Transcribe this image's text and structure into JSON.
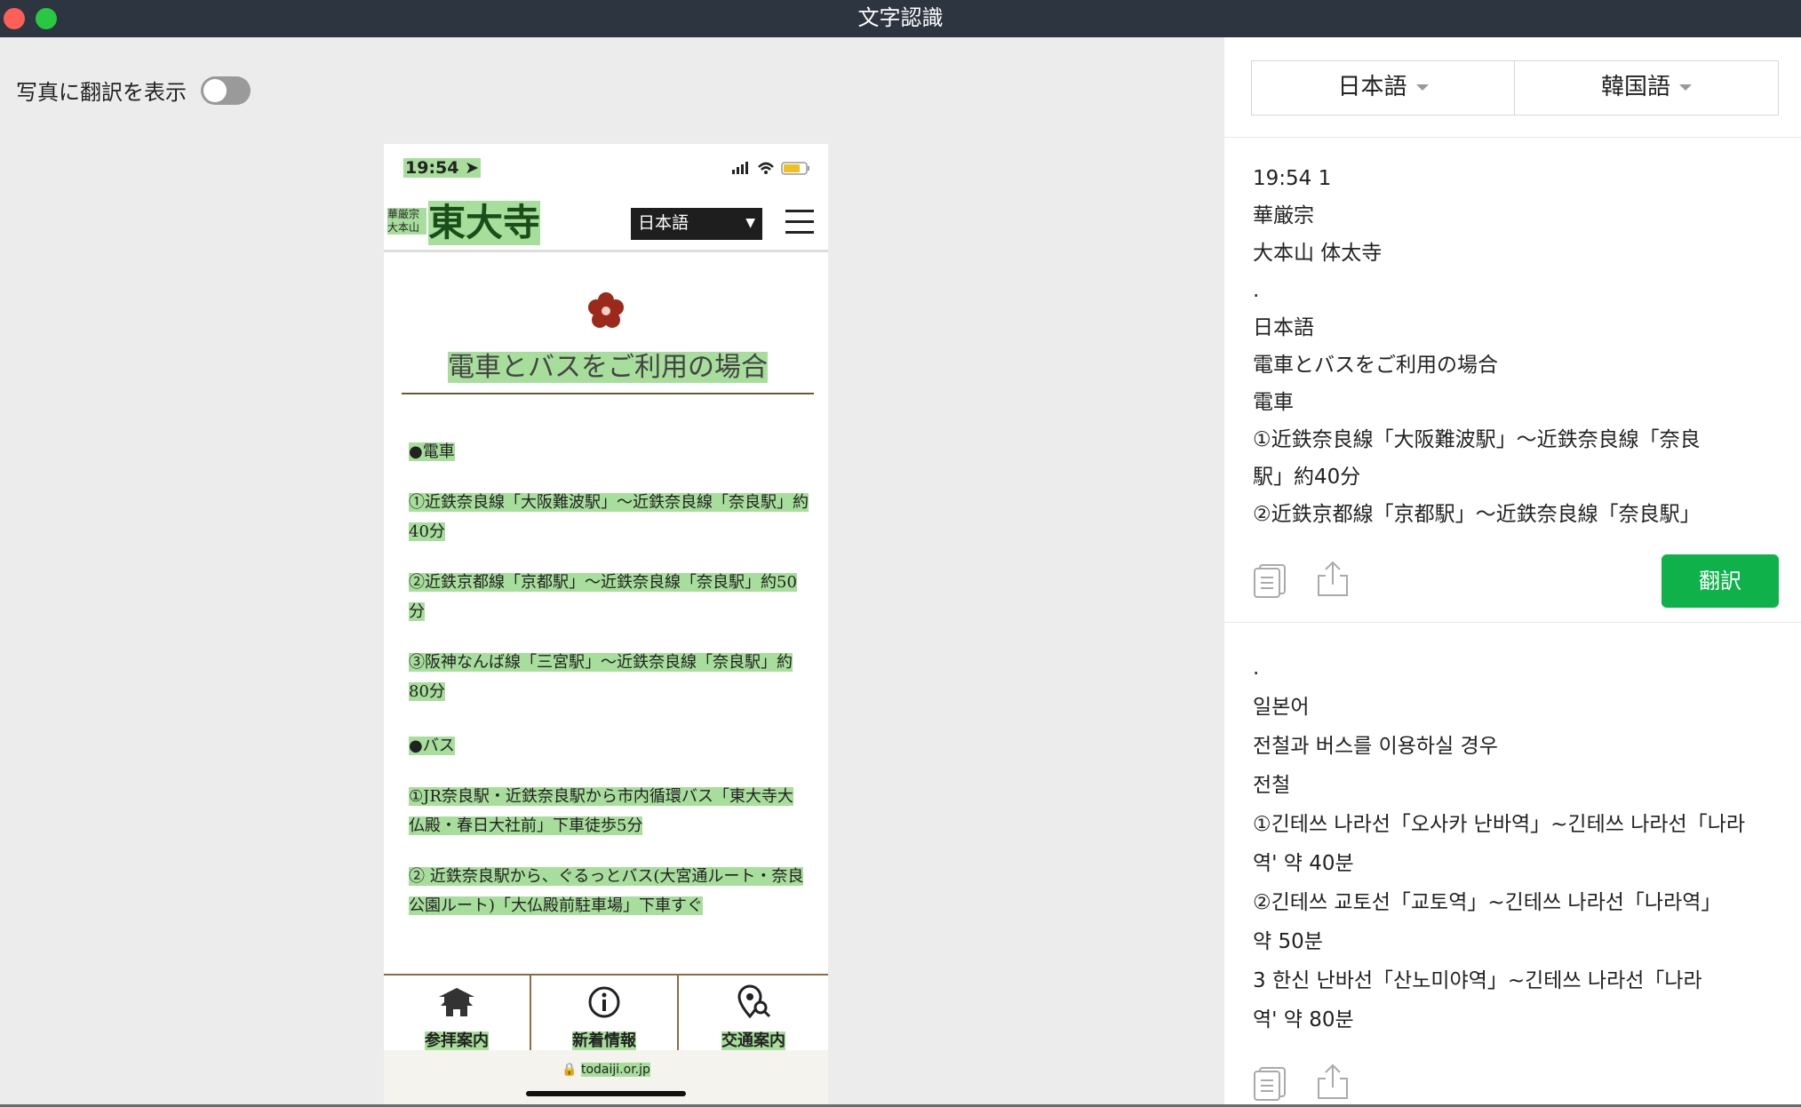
{
  "window": {
    "title": "文字認識",
    "close_color": "#ff5f57",
    "zoom_color": "#28c840"
  },
  "left": {
    "toggle_label": "写真に翻訳を表示",
    "toggle_on": false
  },
  "phone": {
    "status_time": "19:54",
    "logo_small": "華厳宗\n大本山",
    "logo_big": "東大寺",
    "lang_select": "日本語",
    "heading": "電車とバスをご利用の場合",
    "body": [
      "●電車",
      "①近鉄奈良線「大阪難波駅」〜近鉄奈良線「奈良駅」約40分",
      "②近鉄京都線「京都駅」〜近鉄奈良線「奈良駅」約50分",
      "③阪神なんば線「三宮駅」〜近鉄奈良線「奈良駅」約80分",
      "●バス",
      "①JR奈良駅・近鉄奈良駅から市内循環バス「東大寺大仏殿・春日大社前」下車徒歩5分",
      "② 近鉄奈良駅から、ぐるっとバス(大宮通ルート・奈良公園ルート)「大仏殿前駐車場」下車すぐ"
    ],
    "tabs": [
      "参拝案内",
      "新着情報",
      "交通案内"
    ],
    "url": "todaiji.or.jp",
    "highlight_color": "#a7de9b"
  },
  "right": {
    "source_lang": "日本語",
    "target_lang": "韓国語",
    "source_lines": [
      "19:54 1",
      "華厳宗",
      "大本山 体太寺",
      ".",
      "日本語",
      "電車とバスをご利用の場合",
      "電車",
      "①近鉄奈良線「大阪難波駅」〜近鉄奈良線「奈良",
      "駅」約40分",
      "②近鉄京都線「京都駅」〜近鉄奈良線「奈良駅」"
    ],
    "translate_button": "翻訳",
    "translate_color": "#0fb24a",
    "target_lines": [
      ".",
      "일본어",
      "전철과 버스를 이용하실 경우",
      "전철",
      "①긴테쓰 나라선「오사카 난바역」~긴테쓰 나라선「나라",
      "역' 약 40분",
      "②긴테쓰 교토선「교토역」~긴테쓰 나라선「나라역」",
      "약 50분",
      "3 한신 난바선「산노미야역」~긴테쓰 나라선「나라",
      "역' 약 80분"
    ]
  }
}
